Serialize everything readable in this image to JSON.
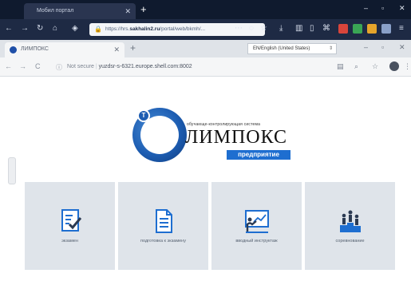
{
  "outer_browser": {
    "tab_title": "Мобил портал",
    "url_prefix": "https://hrs.",
    "url_host": "sakhalin2.ru",
    "url_rest": "/portal/web/bkmh/...",
    "more_label": "⋯"
  },
  "inner_browser": {
    "tab_title": "ЛИМПОКС",
    "not_secure_label": "Not secure",
    "url": "yuzdsr-s-6321.europe.shell.com:8002",
    "language_selected": "EN/English (United States)"
  },
  "logo": {
    "badge": "T",
    "tagline": "обучающе-контролирующая система",
    "name": "ЛИМПОКС",
    "edition": "предприятие"
  },
  "tiles": [
    {
      "label": "экзамен",
      "icon": "exam-checklist-icon"
    },
    {
      "label": "подготовка к экзамену",
      "icon": "document-icon"
    },
    {
      "label": "вводный инструктаж",
      "icon": "presentation-board-icon"
    },
    {
      "label": "соревнование",
      "icon": "podium-icon"
    }
  ],
  "colors": {
    "tile_bg": "#dfe4ea",
    "icon_blue": "#1e6ed0",
    "edition_bg": "#1e6ed0"
  }
}
